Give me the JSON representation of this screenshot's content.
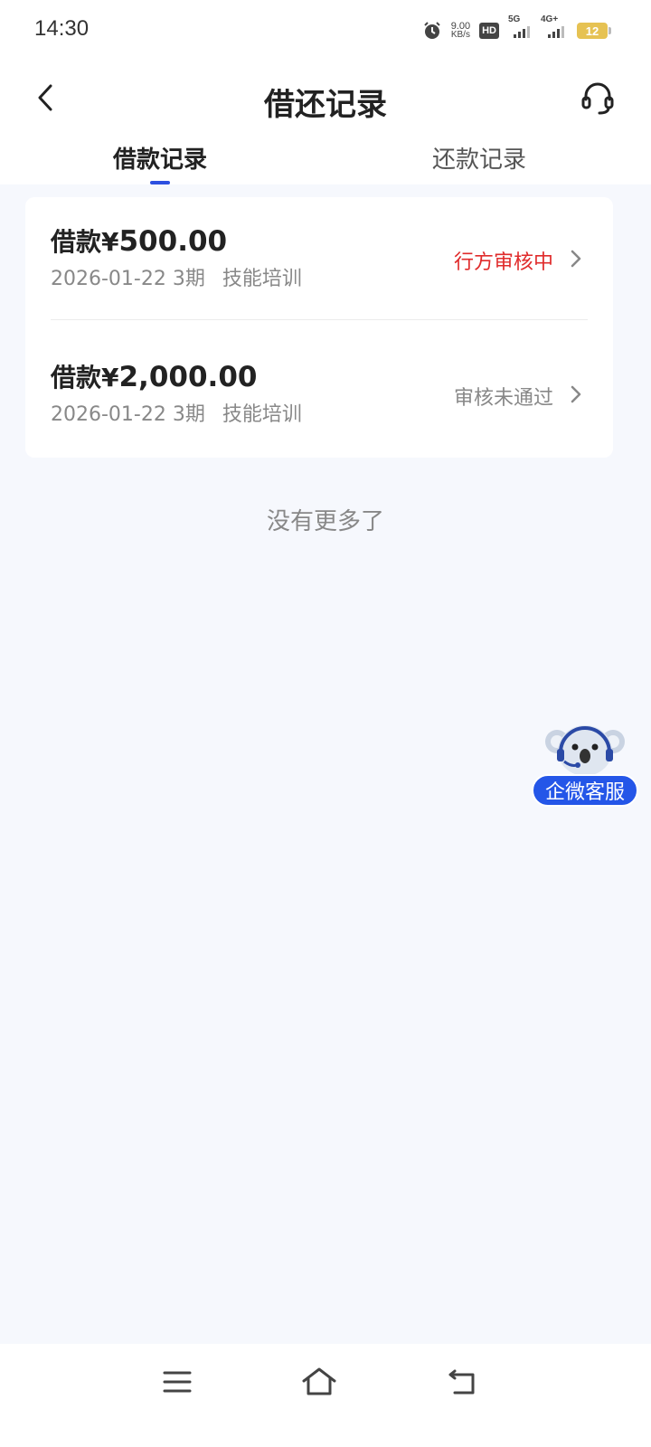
{
  "status_bar": {
    "time": "14:30",
    "net_speed_value": "9.00",
    "net_speed_unit": "KB/s",
    "hd_label": "HD",
    "signal_1_label": "5G",
    "signal_2_label": "4G+",
    "battery_level": "12",
    "icons": [
      "alarm-icon",
      "hd-icon",
      "signal-5g-icon",
      "signal-4g-icon",
      "battery-icon"
    ]
  },
  "header": {
    "title": "借还记录",
    "back_icon": "chevron-left-icon",
    "support_icon": "headset-icon"
  },
  "tabs": [
    {
      "label": "借款记录",
      "active": true
    },
    {
      "label": "还款记录",
      "active": false
    }
  ],
  "records": [
    {
      "amount_prefix": "借款¥",
      "amount_value": "500.00",
      "date": "2026-01-22",
      "term": "3期",
      "purpose": "技能培训",
      "status": "行方审核中",
      "status_color": "#e02b2b"
    },
    {
      "amount_prefix": "借款¥",
      "amount_value": "2,000.00",
      "date": "2026-01-22",
      "term": "3期",
      "purpose": "技能培训",
      "status": "审核未通过",
      "status_color": "#888888"
    }
  ],
  "no_more_text": "没有更多了",
  "float_service": {
    "label": "企微客服",
    "icon": "koala-mascot-icon"
  },
  "nav_bar": {
    "icons": [
      "menu-icon",
      "home-icon",
      "back-icon"
    ]
  },
  "colors": {
    "accent": "#2c4fe0",
    "background": "#f6f8fd",
    "status_pending": "#e02b2b",
    "status_rejected": "#888888"
  }
}
